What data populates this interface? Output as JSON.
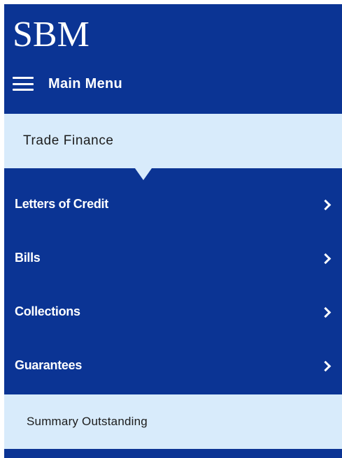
{
  "brand": {
    "logo_text": "SBM"
  },
  "header": {
    "menu_icon": "hamburger-icon",
    "main_menu_label": "Main Menu"
  },
  "section": {
    "title": "Trade Finance"
  },
  "menu": {
    "items": [
      {
        "label": "Letters of Credit",
        "icon": "chevron-right-icon"
      },
      {
        "label": "Bills",
        "icon": "chevron-right-icon"
      },
      {
        "label": "Collections",
        "icon": "chevron-right-icon"
      },
      {
        "label": "Guarantees",
        "icon": "chevron-right-icon"
      }
    ],
    "summary_label": "Summary Outstanding"
  },
  "colors": {
    "sidebar_bg": "#0b3494",
    "highlight_bg": "#d8ebfb",
    "text_light": "#ffffff",
    "text_dark": "#1c1c1c"
  }
}
